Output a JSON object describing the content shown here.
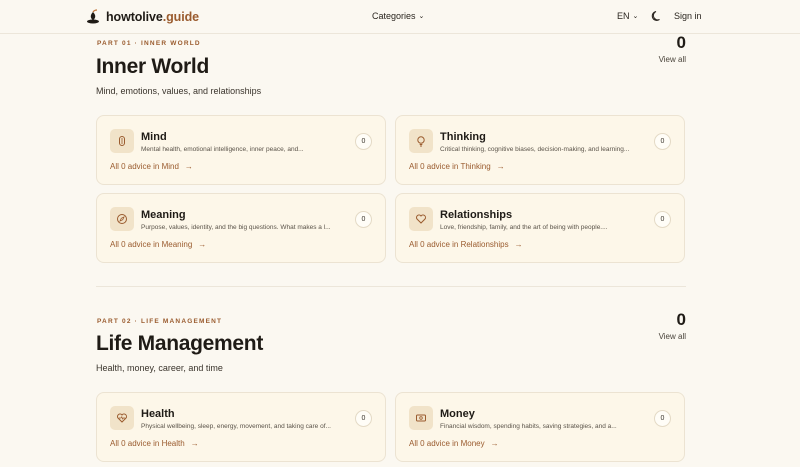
{
  "header": {
    "logo_main": "howtolive",
    "logo_accent": ".guide",
    "categories_label": "Categories",
    "language": "EN",
    "signin_label": "Sign in"
  },
  "sections": [
    {
      "part": "PART 01 · INNER WORLD",
      "title": "Inner World",
      "subtitle": "Mind, emotions, values, and relationships",
      "count": "0",
      "view_all": "View all",
      "cards": [
        {
          "title": "Mind",
          "desc": "Mental health, emotional intelligence, inner peace, and...",
          "count": "0",
          "link": "All 0 advice in Mind",
          "icon": "brain-icon"
        },
        {
          "title": "Thinking",
          "desc": "Critical thinking, cognitive biases, decision-making, and learning...",
          "count": "0",
          "link": "All 0 advice in Thinking",
          "icon": "lightbulb-icon"
        },
        {
          "title": "Meaning",
          "desc": "Purpose, values, identity, and the big questions. What makes a l...",
          "count": "0",
          "link": "All 0 advice in Meaning",
          "icon": "compass-icon"
        },
        {
          "title": "Relationships",
          "desc": "Love, friendship, family, and the art of being with people....",
          "count": "0",
          "link": "All 0 advice in Relationships",
          "icon": "heart-icon"
        }
      ]
    },
    {
      "part": "PART 02 · LIFE MANAGEMENT",
      "title": "Life Management",
      "subtitle": "Health, money, career, and time",
      "count": "0",
      "view_all": "View all",
      "cards": [
        {
          "title": "Health",
          "desc": "Physical wellbeing, sleep, energy, movement, and taking care of...",
          "count": "0",
          "link": "All 0 advice in Health",
          "icon": "heart-pulse-icon"
        },
        {
          "title": "Money",
          "desc": "Financial wisdom, spending habits, saving strategies, and a...",
          "count": "0",
          "link": "All 0 advice in Money",
          "icon": "banknote-icon"
        }
      ]
    }
  ],
  "link_arrow": "→",
  "colors": {
    "accent": "#9a5b2e",
    "background": "#fbf8f1",
    "card": "#fdf7e9"
  }
}
